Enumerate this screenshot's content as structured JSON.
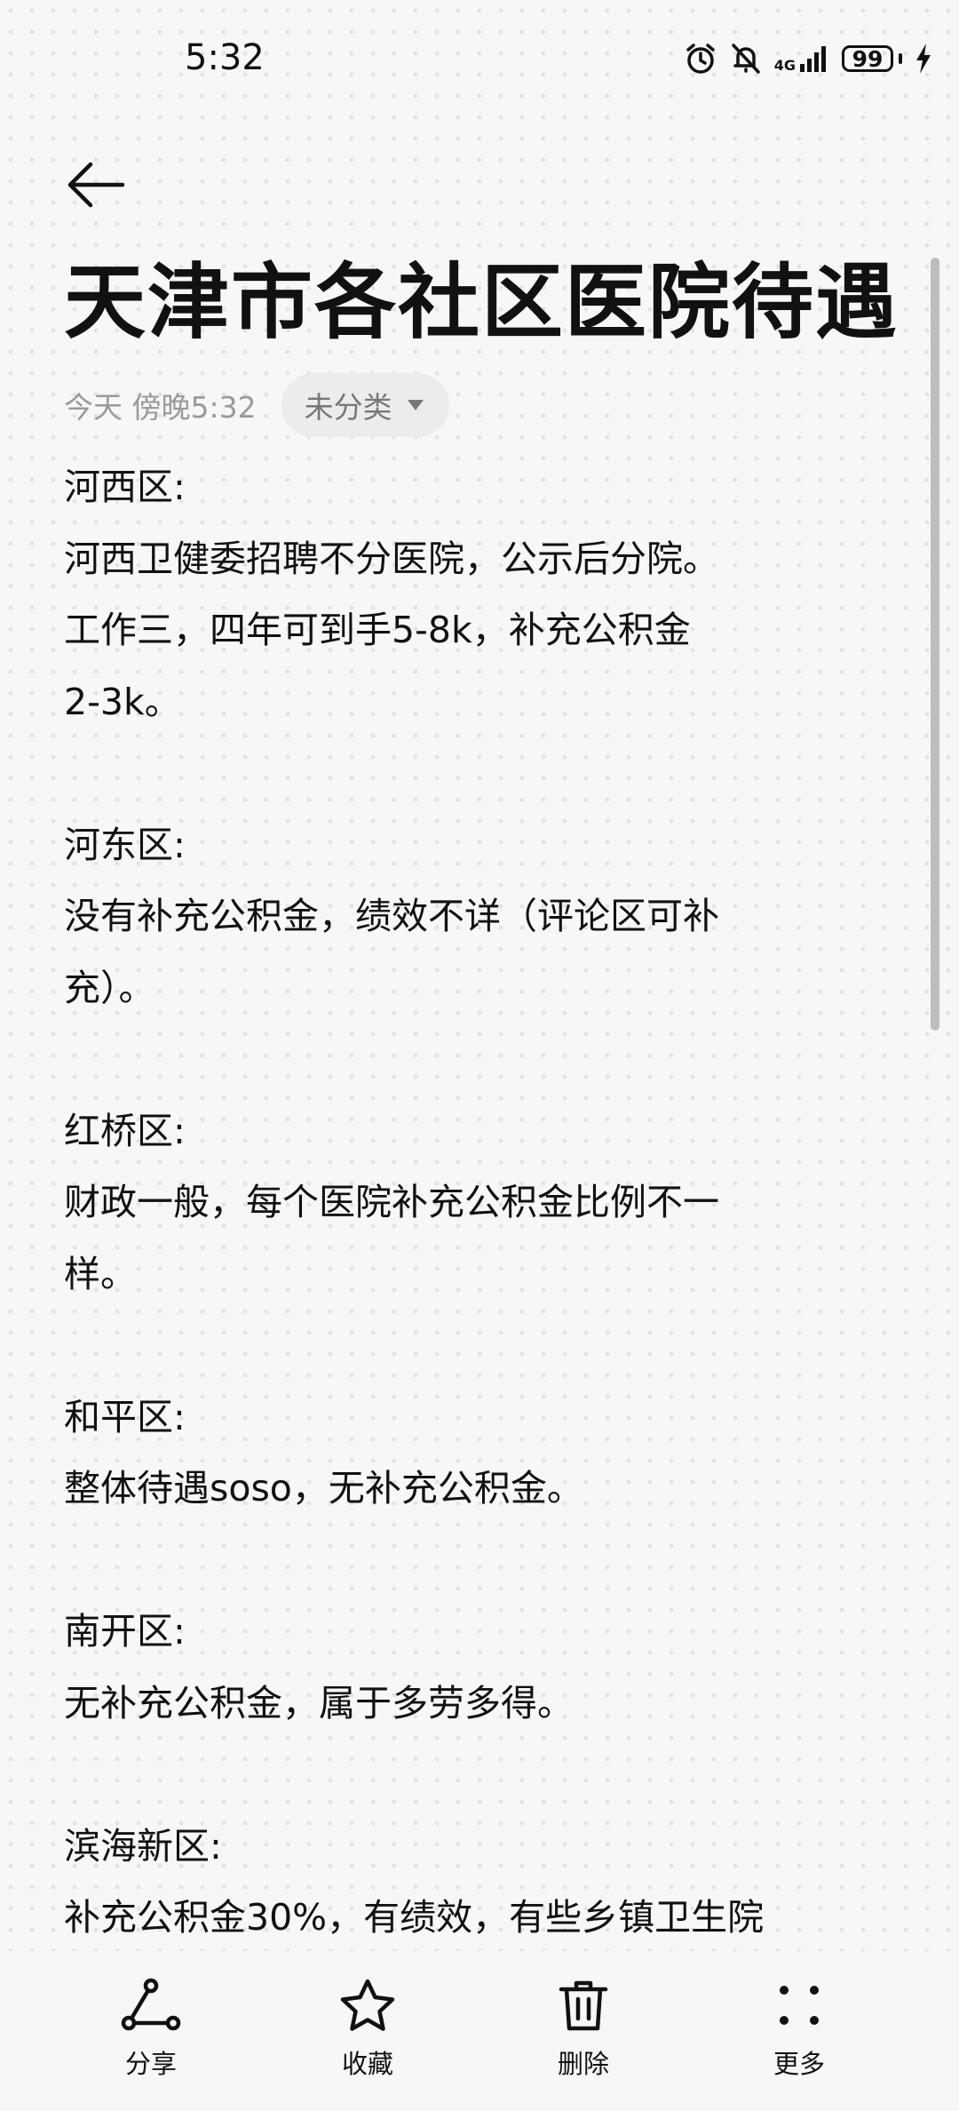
{
  "status_bar": {
    "time": "5:32",
    "network": "4G",
    "battery": "99",
    "icons": [
      "alarm-icon",
      "mute-icon",
      "signal-icon",
      "battery-icon",
      "charging-icon"
    ]
  },
  "note": {
    "title": "天津市各社区医院待遇",
    "timestamp": "今天 傍晚5:32",
    "category": "未分类",
    "body": "河西区:\n河西卫健委招聘不分医院，公示后分院。\n工作三，四年可到手5-8k，补充公积金\n2-3k。\n\n河东区:\n没有补充公积金，绩效不详（评论区可补\n充）。\n\n红桥区:\n财政一般，每个医院补充公积金比例不一\n样。\n\n和平区:\n整体待遇soso，无补充公积金。\n\n南开区:\n无补充公积金，属于多劳多得。\n\n滨海新区:\n补充公积金30%，有绩效，有些乡镇卫生院"
  },
  "bottom_bar": {
    "share": "分享",
    "favorite": "收藏",
    "delete": "删除",
    "more": "更多"
  }
}
